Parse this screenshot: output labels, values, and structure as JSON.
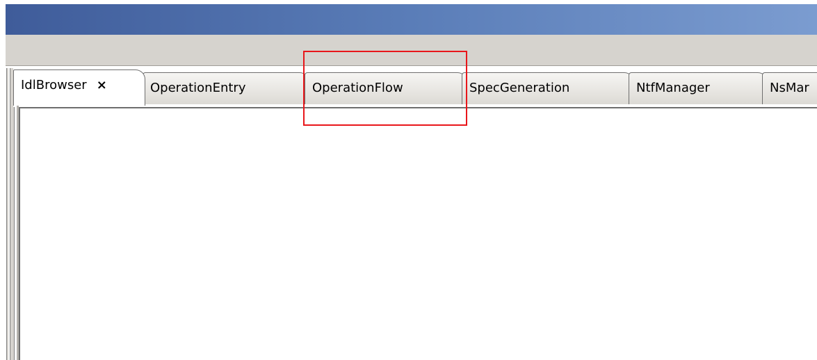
{
  "tabs": [
    {
      "label": "IdlBrowser",
      "active": true,
      "closable": true,
      "close_glyph": "×"
    },
    {
      "label": "OperationEntry",
      "active": false
    },
    {
      "label": "OperationFlow",
      "active": false
    },
    {
      "label": "SpecGeneration",
      "active": false
    },
    {
      "label": "NtfManager",
      "active": false
    },
    {
      "label": "NsMar",
      "active": false
    }
  ],
  "colors": {
    "titlebar_start": "#3f5c9a",
    "titlebar_end": "#7b9cd0",
    "toolbar": "#d6d3ce",
    "highlight": "#e8161a"
  },
  "annotation": {
    "target": "tab-operationflow",
    "style": "red-rectangle"
  }
}
